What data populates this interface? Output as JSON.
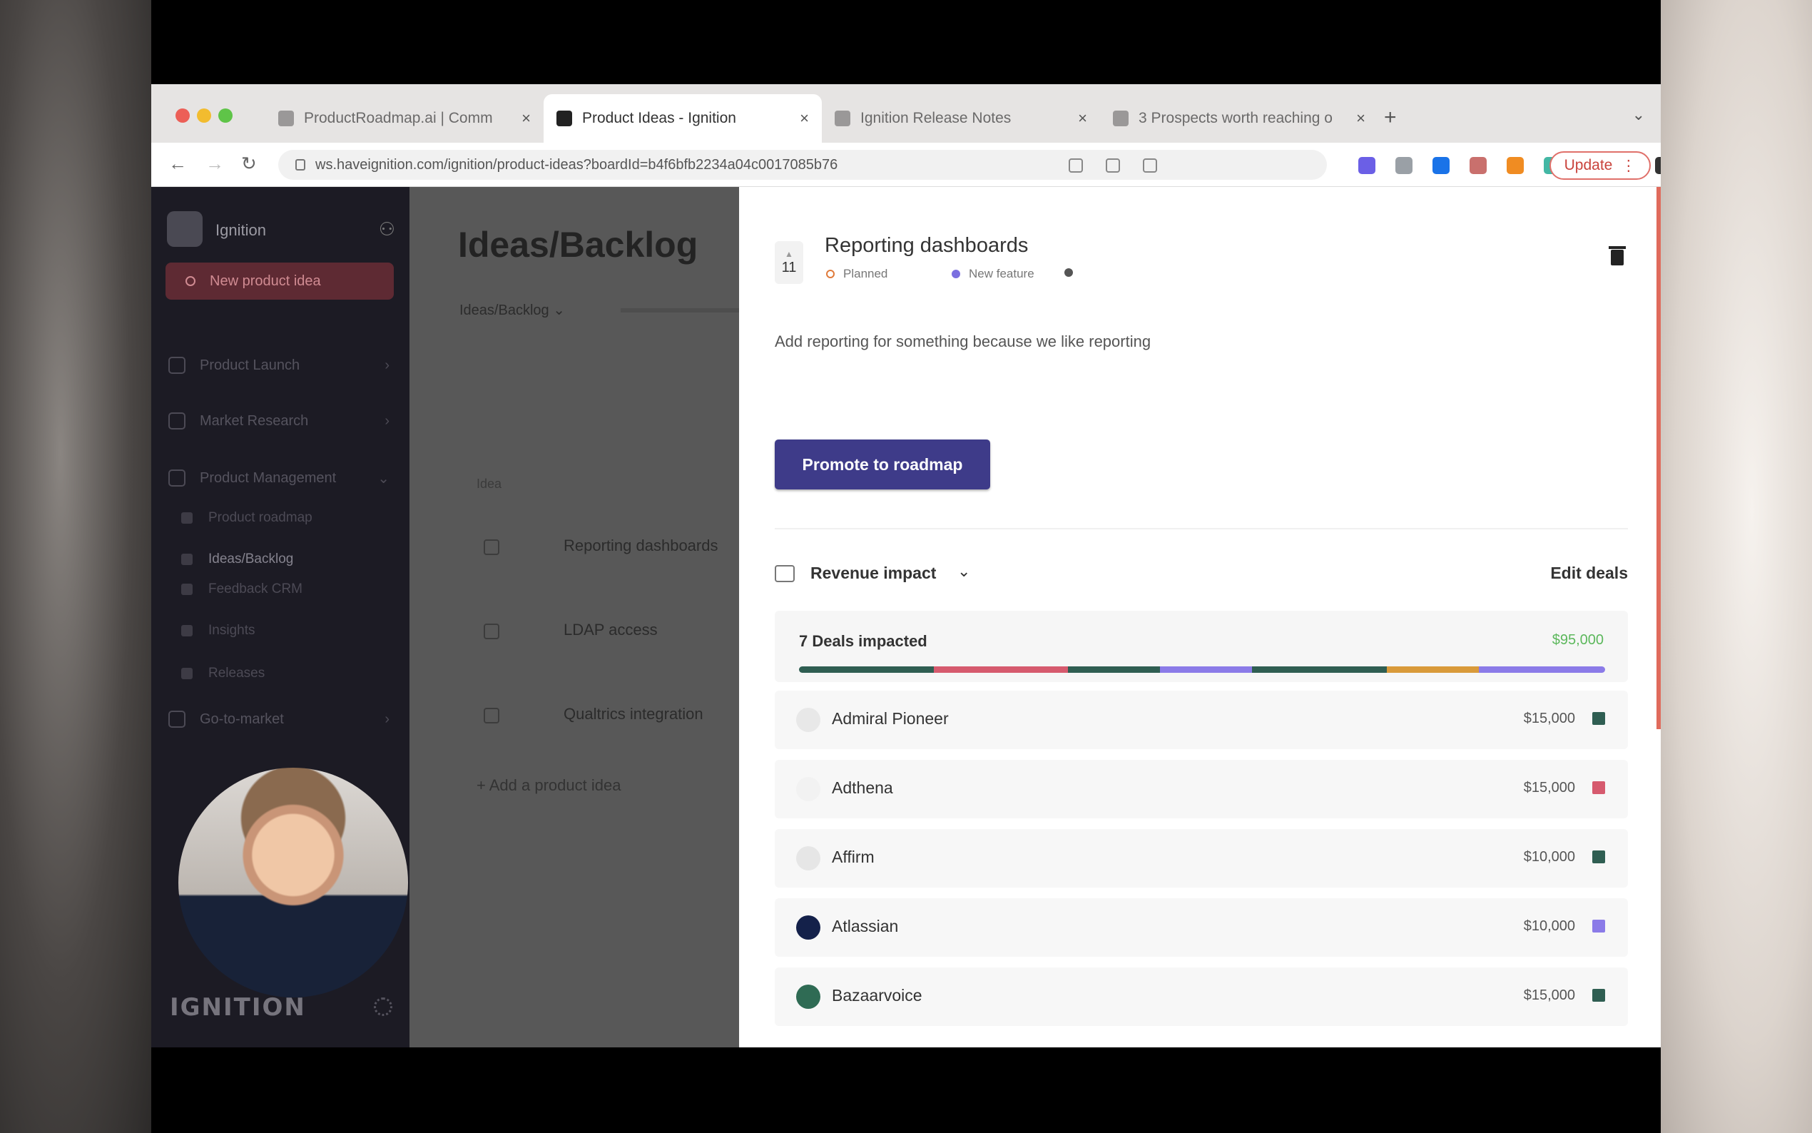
{
  "browser": {
    "tabs": [
      {
        "title": "ProductRoadmap.ai | Comm",
        "active": false
      },
      {
        "title": "Product Ideas - Ignition",
        "active": true
      },
      {
        "title": "Ignition Release Notes",
        "active": false
      },
      {
        "title": "3 Prospects worth reaching o",
        "active": false
      }
    ],
    "url": "ws.haveignition.com/ignition/product-ideas?boardId=b4f6bfb2234a04c0017085b76",
    "update_label": "Update",
    "extension_colors": [
      "#6b5fe6",
      "#9aa0a6",
      "#1a73e8",
      "#c9706d",
      "#f08c22",
      "#43b7a4",
      "#555555",
      "#777777",
      "#333333",
      "#5f5bd0"
    ]
  },
  "sidebar": {
    "workspace": "Ignition",
    "new_button": "New product idea",
    "items": [
      {
        "label": "Product Launch"
      },
      {
        "label": "Market Research"
      },
      {
        "label": "Product Management"
      }
    ],
    "subitems": [
      {
        "label": "Product roadmap",
        "active": false
      },
      {
        "label": "Ideas/Backlog",
        "active": true
      },
      {
        "label": "Feedback CRM",
        "active": false
      },
      {
        "label": "Insights",
        "active": false
      },
      {
        "label": "Releases",
        "active": false
      }
    ],
    "footer_item": "Go-to-market",
    "brand": "IGNITION"
  },
  "main": {
    "title": "Ideas/Backlog",
    "tab": "Ideas/Backlog",
    "column_header": "Idea",
    "rows": [
      {
        "text": "Reporting dashboards"
      },
      {
        "text": "LDAP access"
      },
      {
        "text": "Qualtrics integration"
      }
    ],
    "add_label": "+ Add a product idea"
  },
  "panel": {
    "vote_count": "11",
    "title": "Reporting dashboards",
    "status": "Planned",
    "tag": "New feature",
    "description": "Add reporting for something because we like reporting",
    "promote_label": "Promote to roadmap",
    "revenue_label": "Revenue impact",
    "edit_label": "Edit deals",
    "deals_count": "7 Deals impacted",
    "deals_total": "$95,000",
    "segments": [
      {
        "fraction": 0.167,
        "color": "#2f5e52"
      },
      {
        "fraction": 0.167,
        "color": "#d65a6e"
      },
      {
        "fraction": 0.114,
        "color": "#2f5e52"
      },
      {
        "fraction": 0.114,
        "color": "#8b7be8"
      },
      {
        "fraction": 0.167,
        "color": "#2f5e52"
      },
      {
        "fraction": 0.114,
        "color": "#d99a3a"
      },
      {
        "fraction": 0.157,
        "color": "#8b7be8"
      }
    ],
    "deals": [
      {
        "name": "Admiral Pioneer",
        "amount": "$15,000",
        "color": "#2f5e52",
        "logo_color": "#e8e8e8"
      },
      {
        "name": "Adthena",
        "amount": "$15,000",
        "color": "#d65a6e",
        "logo_color": "#f2f2f2"
      },
      {
        "name": "Affirm",
        "amount": "$10,000",
        "color": "#2f5e52",
        "logo_color": "#e6e6e6"
      },
      {
        "name": "Atlassian",
        "amount": "$10,000",
        "color": "#8b7be8",
        "logo_color": "#14214a"
      },
      {
        "name": "Bazaarvoice",
        "amount": "$15,000",
        "color": "#2f5e52",
        "logo_color": "#2f6b54"
      }
    ]
  }
}
